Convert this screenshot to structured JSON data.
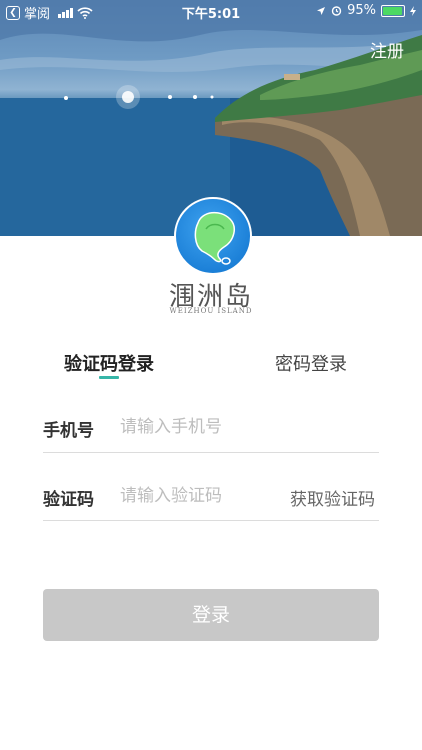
{
  "status_bar": {
    "carrier": "掌阅",
    "time": "下午5:01",
    "battery": "95%",
    "battery_level": 0.95,
    "back_icon": "back-app-icon",
    "wifi_icon": "wifi-icon",
    "location_icon": "location-arrow-icon",
    "alarm_icon": "alarm-icon",
    "charging_icon": "charging-bolt-icon"
  },
  "header": {
    "register_label": "注册"
  },
  "brand": {
    "name": "涠洲岛",
    "subtitle": "WEIZHOU ISLAND"
  },
  "tabs": [
    {
      "label": "验证码登录",
      "active": true
    },
    {
      "label": "密码登录",
      "active": false
    }
  ],
  "form": {
    "phone": {
      "label": "手机号",
      "placeholder": "请输入手机号",
      "value": ""
    },
    "code": {
      "label": "验证码",
      "placeholder": "请输入验证码",
      "value": "",
      "get_code_label": "获取验证码"
    },
    "submit_label": "登录"
  },
  "colors": {
    "accent": "#36b6a8",
    "button_disabled": "#c8c8c8",
    "logo_blue": "#1a7ed6",
    "island_green": "#7be07a"
  }
}
